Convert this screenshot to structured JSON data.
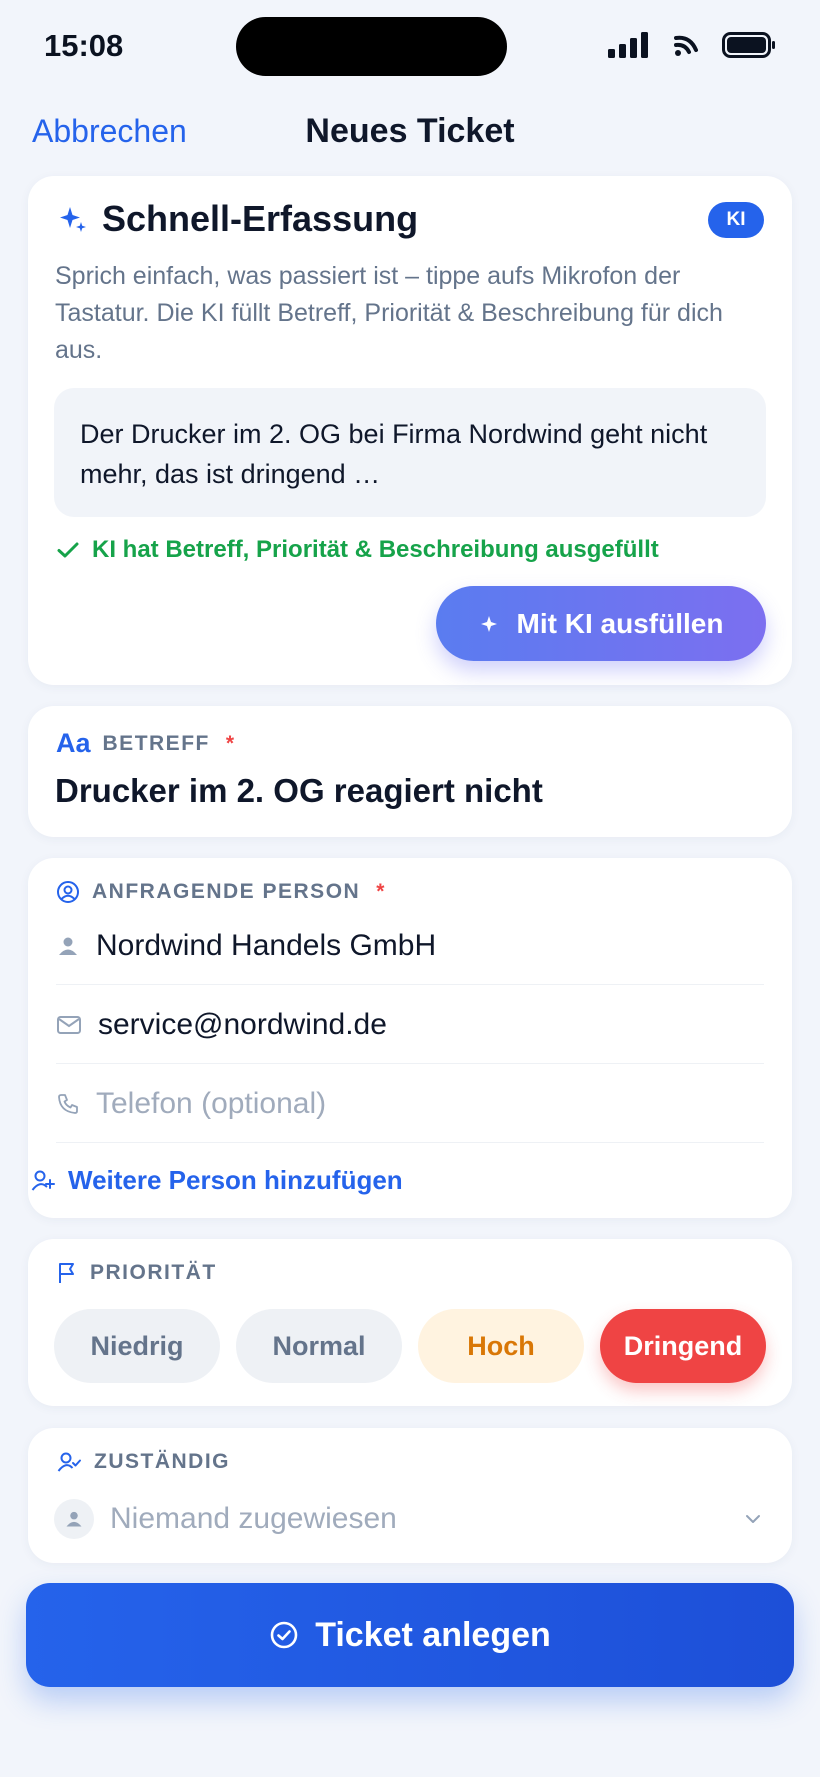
{
  "status_bar": {
    "time": "15:08"
  },
  "nav": {
    "cancel_label": "Abbrechen",
    "title": "Neues Ticket"
  },
  "quick_capture": {
    "title": "Schnell-Erfassung",
    "badge": "KI",
    "description": "Sprich einfach, was passiert ist – tippe aufs Mikrofon der Tastatur. Die KI füllt Betreff, Priorität & Beschreibung für dich aus.",
    "dictation_text": "Der Drucker im 2. OG bei Firma Nordwind geht nicht mehr, das ist dringend …",
    "success_message": "KI hat Betreff, Priorität & Beschreibung ausgefüllt",
    "ai_button_label": "Mit KI ausfüllen"
  },
  "subject": {
    "icon_text": "Aa",
    "label": "BETREFF",
    "required_mark": "*",
    "value": "Drucker im 2. OG reagiert nicht"
  },
  "requester": {
    "label": "ANFRAGENDE PERSON",
    "required_mark": "*",
    "name": "Nordwind Handels GmbH",
    "email": "service@nordwind.de",
    "phone_placeholder": "Telefon (optional)",
    "add_person_label": "Weitere Person hinzufügen"
  },
  "priority": {
    "label": "PRIORITÄT",
    "options": [
      "Niedrig",
      "Normal",
      "Hoch",
      "Dringend"
    ],
    "selected": "Dringend"
  },
  "assignee": {
    "label": "ZUSTÄNDIG",
    "placeholder": "Niemand zugewiesen"
  },
  "submit_label": "Ticket anlegen",
  "colors": {
    "accent": "#2563eb",
    "success": "#16a34a",
    "urgent": "#ef4444",
    "high": "#d97706",
    "background": "#f2f5fb"
  }
}
